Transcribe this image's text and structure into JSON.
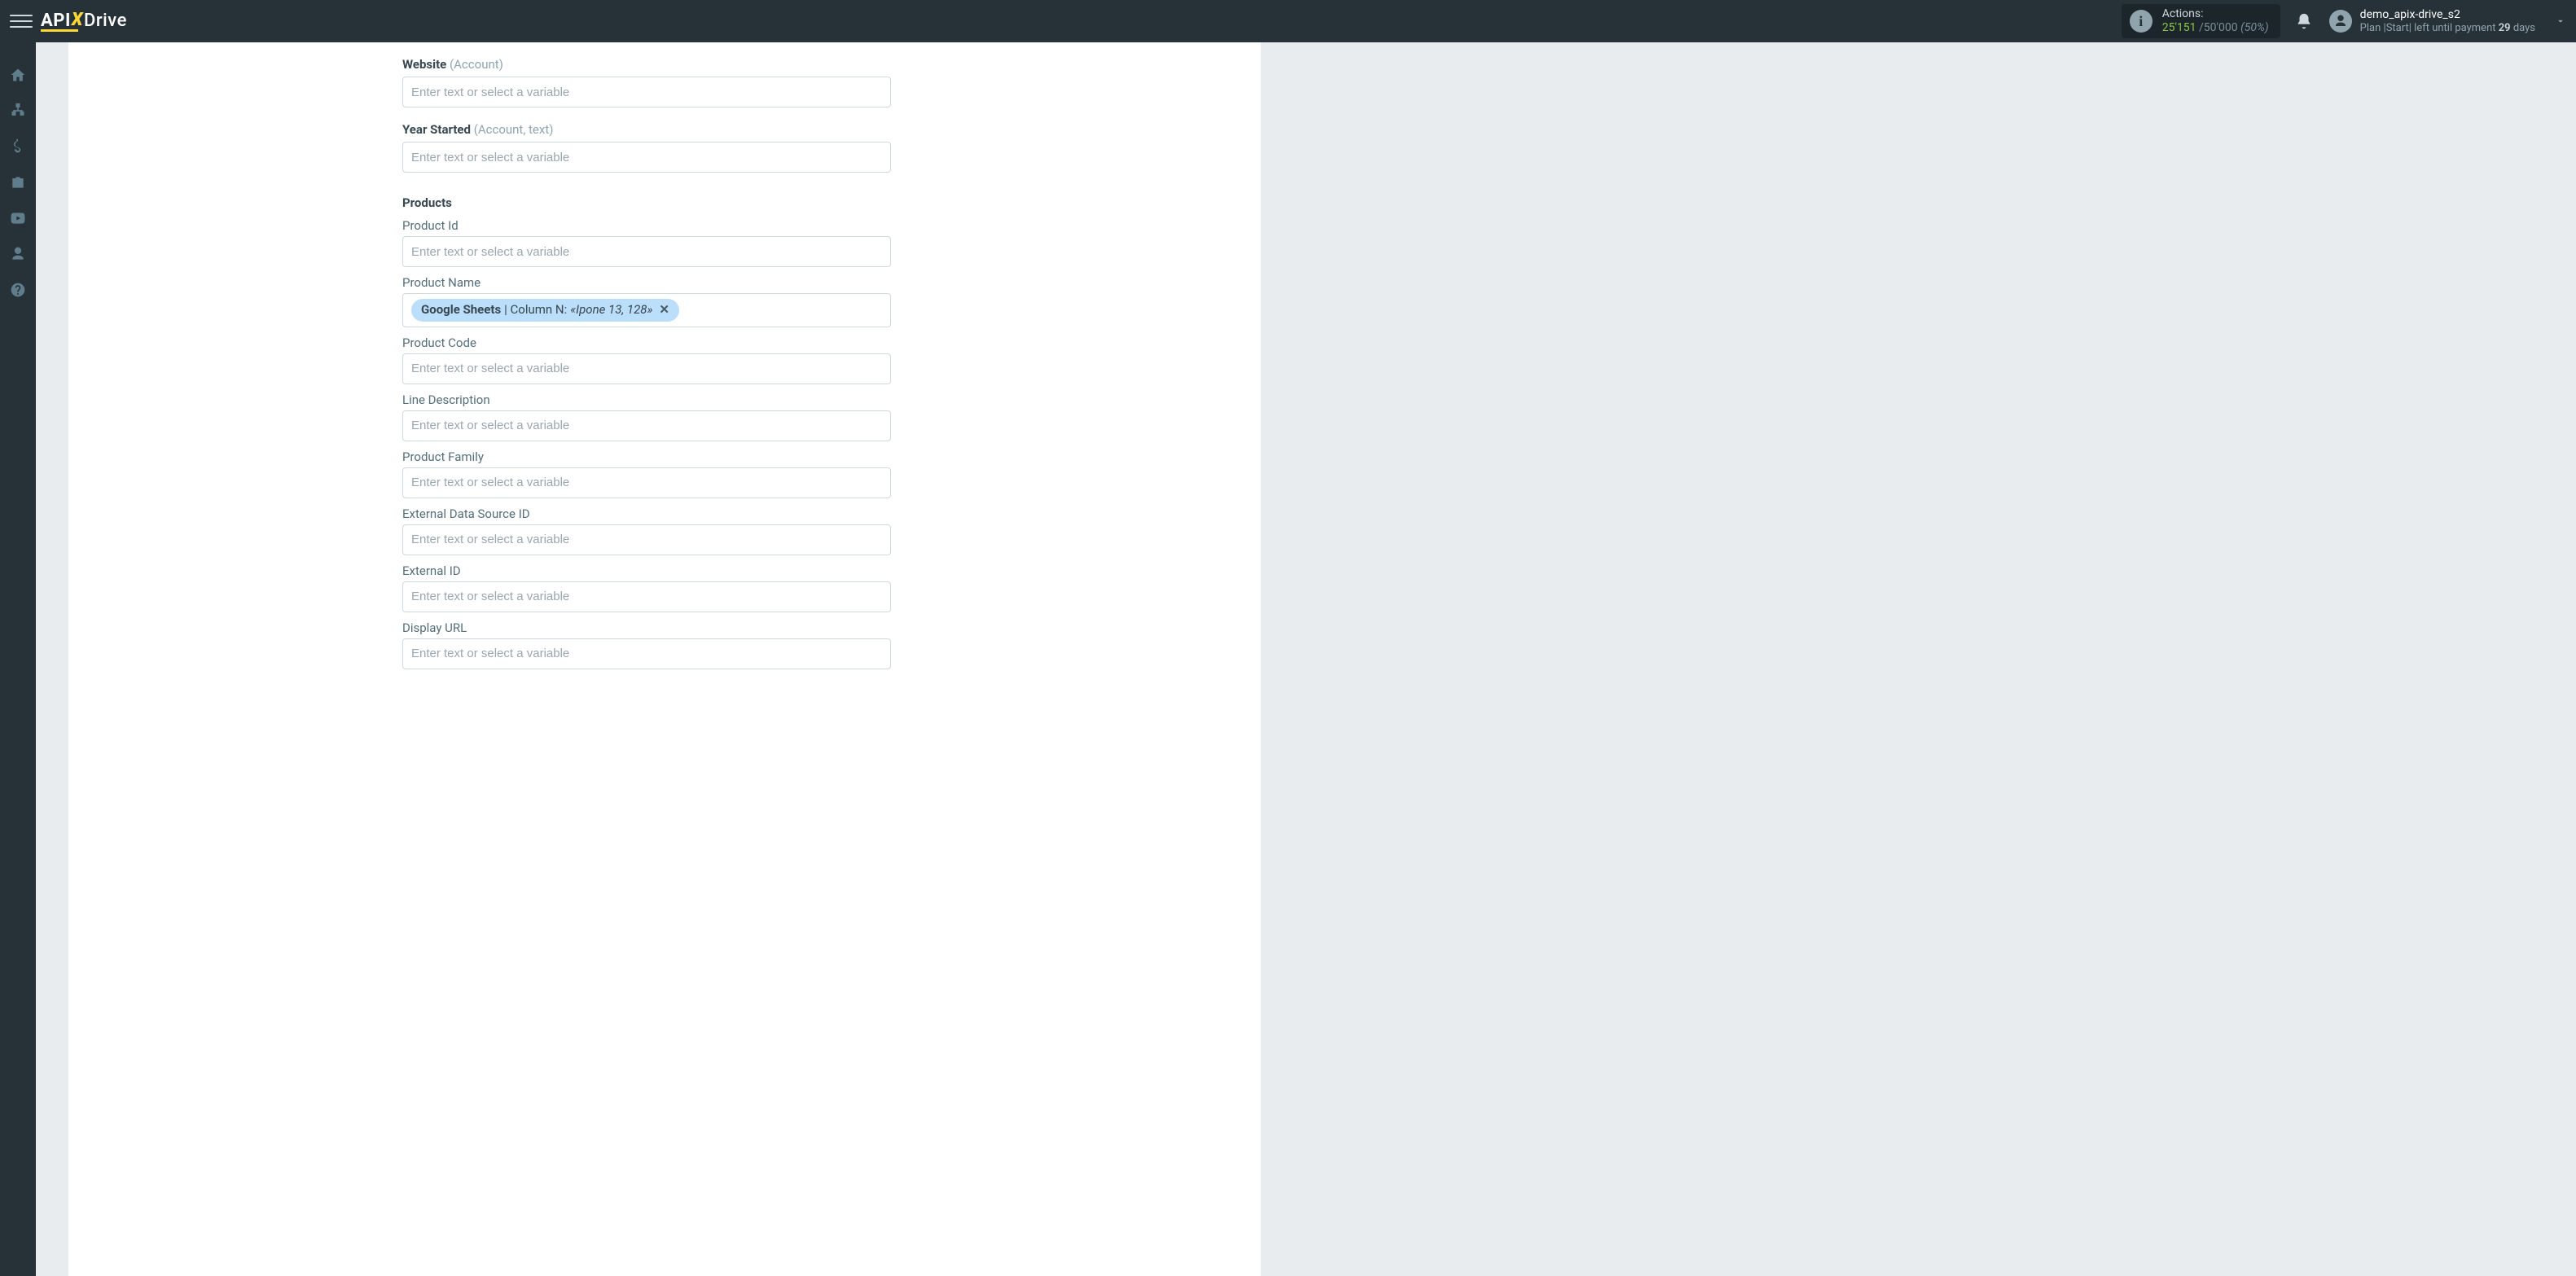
{
  "header": {
    "logo": {
      "part1": "API",
      "x": "X",
      "part2": "Drive"
    },
    "actions": {
      "label": "Actions:",
      "used": "25'151",
      "sep": "/",
      "limit": "50'000",
      "pct": "(50%)"
    },
    "user": {
      "name": "demo_apix-drive_s2",
      "plan_prefix": "Plan ",
      "plan_sep1": "|",
      "plan_name": "Start",
      "plan_sep2": "|",
      "plan_mid": " left until payment ",
      "plan_days": "29",
      "plan_suffix": " days"
    }
  },
  "form": {
    "placeholder": "Enter text or select a variable",
    "fields": [
      {
        "bold": "Website",
        "suffix": " (Account)"
      },
      {
        "bold": "Year Started",
        "suffix": " (Account, text)"
      }
    ],
    "products_title": "Products",
    "product_fields": [
      {
        "label": "Product Id",
        "chip": null
      },
      {
        "label": "Product Name",
        "chip": {
          "src": "Google Sheets",
          "sep": " | ",
          "col": "Column N: ",
          "val": "«Ipone 13, 128»"
        }
      },
      {
        "label": "Product Code",
        "chip": null
      },
      {
        "label": "Line Description",
        "chip": null
      },
      {
        "label": "Product Family",
        "chip": null
      },
      {
        "label": "External Data Source ID",
        "chip": null
      },
      {
        "label": "External ID",
        "chip": null
      },
      {
        "label": "Display URL",
        "chip": null
      }
    ]
  }
}
